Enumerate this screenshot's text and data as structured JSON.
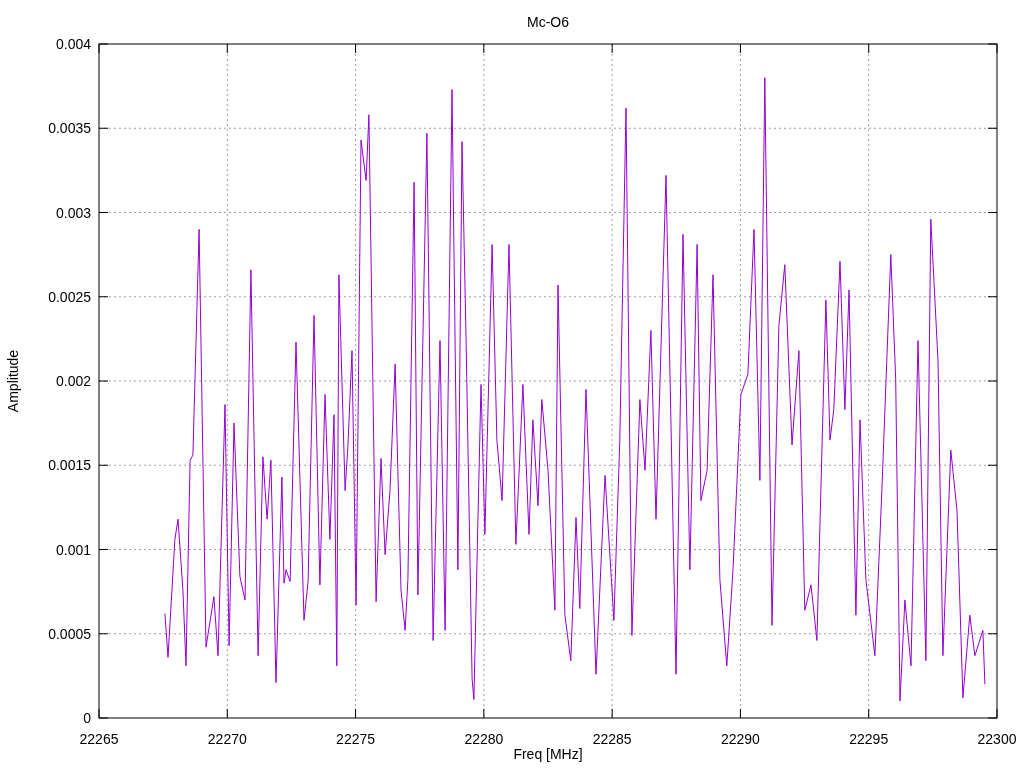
{
  "chart_data": {
    "type": "line",
    "grid": true,
    "title": "Mc-O6",
    "xlabel": "Freq [MHz]",
    "ylabel": "Amplitude",
    "xlim": [
      22265,
      22300
    ],
    "ylim": [
      0,
      0.004
    ],
    "xticks": [
      22265,
      22270,
      22275,
      22280,
      22285,
      22290,
      22295,
      22300
    ],
    "yticks": [
      0,
      0.0005,
      0.001,
      0.0015,
      0.002,
      0.0025,
      0.003,
      0.0035,
      0.004
    ],
    "x": [
      22267.57,
      22267.69,
      22267.96,
      22268.08,
      22268.27,
      22268.39,
      22268.55,
      22268.66,
      22268.9,
      22269.17,
      22269.48,
      22269.64,
      22269.91,
      22270.07,
      22270.26,
      22270.49,
      22270.69,
      22270.92,
      22271.2,
      22271.39,
      22271.55,
      22271.7,
      22271.9,
      22272.13,
      22272.21,
      22272.29,
      22272.45,
      22272.68,
      22272.99,
      22273.15,
      22273.38,
      22273.61,
      22273.81,
      22274.0,
      22274.16,
      22274.27,
      22274.35,
      22274.59,
      22274.7,
      22274.86,
      22275.02,
      22275.21,
      22275.41,
      22275.52,
      22275.8,
      22275.99,
      22276.15,
      22276.34,
      22276.54,
      22276.77,
      22276.93,
      22277.04,
      22277.28,
      22277.43,
      22277.78,
      22278.02,
      22278.29,
      22278.49,
      22278.76,
      22278.99,
      22279.15,
      22279.3,
      22279.54,
      22279.61,
      22279.89,
      22280.04,
      22280.32,
      22280.51,
      22280.71,
      22280.98,
      22281.25,
      22281.52,
      22281.76,
      22281.91,
      22282.11,
      22282.26,
      22282.5,
      22282.77,
      22282.89,
      22283.16,
      22283.39,
      22283.59,
      22283.74,
      22283.98,
      22284.37,
      22284.72,
      22285.07,
      22285.3,
      22285.54,
      22285.77,
      22286.08,
      22286.28,
      22286.51,
      22286.71,
      22287.1,
      22287.49,
      22287.76,
      22288.03,
      22288.31,
      22288.46,
      22288.7,
      22288.93,
      22289.2,
      22289.47,
      22289.71,
      22290.02,
      22290.29,
      22290.53,
      22290.76,
      22290.95,
      22291.23,
      22291.5,
      22291.73,
      22292.01,
      22292.28,
      22292.51,
      22292.75,
      22292.98,
      22293.33,
      22293.49,
      22293.64,
      22293.88,
      22294.07,
      22294.23,
      22294.5,
      22294.66,
      22294.89,
      22295.24,
      22295.51,
      22295.86,
      22296.05,
      22296.22,
      22296.41,
      22296.65,
      22296.92,
      22297.23,
      22297.42,
      22297.7,
      22297.89,
      22298.2,
      22298.44,
      22298.67,
      22298.94,
      22299.14,
      22299.45,
      22299.53
    ],
    "series": [
      {
        "color": "#9400d3",
        "values": [
          0.00062,
          0.00036,
          0.00106,
          0.00118,
          0.00076,
          0.00031,
          0.00153,
          0.00156,
          0.0029,
          0.00042,
          0.00072,
          0.00037,
          0.00186,
          0.00043,
          0.00175,
          0.00084,
          0.0007,
          0.00266,
          0.00037,
          0.00155,
          0.00118,
          0.00153,
          0.00021,
          0.00143,
          0.0008,
          0.00088,
          0.00081,
          0.00223,
          0.00058,
          0.00081,
          0.00239,
          0.00079,
          0.00192,
          0.00106,
          0.0018,
          0.00031,
          0.00263,
          0.00135,
          0.00161,
          0.00218,
          0.00067,
          0.00343,
          0.00319,
          0.00358,
          0.00069,
          0.00154,
          0.00097,
          0.00135,
          0.0021,
          0.00076,
          0.00052,
          0.00082,
          0.00318,
          0.00073,
          0.00347,
          0.00046,
          0.00224,
          0.00052,
          0.00373,
          0.00088,
          0.00342,
          0.0023,
          0.00023,
          0.00011,
          0.00198,
          0.00109,
          0.00281,
          0.00165,
          0.00129,
          0.00281,
          0.00103,
          0.00198,
          0.00109,
          0.00177,
          0.00126,
          0.00189,
          0.00147,
          0.00064,
          0.00257,
          0.00061,
          0.00034,
          0.00119,
          0.00065,
          0.00195,
          0.00026,
          0.00144,
          0.00058,
          0.00165,
          0.00362,
          0.00049,
          0.00189,
          0.00147,
          0.0023,
          0.00118,
          0.00322,
          0.00026,
          0.00287,
          0.00088,
          0.00281,
          0.00129,
          0.00147,
          0.00263,
          0.00082,
          0.00031,
          0.00088,
          0.00192,
          0.00204,
          0.0029,
          0.00141,
          0.0038,
          0.00055,
          0.00233,
          0.00269,
          0.00162,
          0.00218,
          0.00064,
          0.00079,
          0.00046,
          0.00248,
          0.00165,
          0.00183,
          0.00271,
          0.00183,
          0.00254,
          0.00061,
          0.00177,
          0.00082,
          0.00037,
          0.00134,
          0.00275,
          0.00201,
          0.0001,
          0.0007,
          0.00031,
          0.00224,
          0.00034,
          0.00296,
          0.00212,
          0.00037,
          0.00159,
          0.00123,
          0.00012,
          0.00061,
          0.00037,
          0.00052,
          0.0002
        ]
      }
    ]
  }
}
